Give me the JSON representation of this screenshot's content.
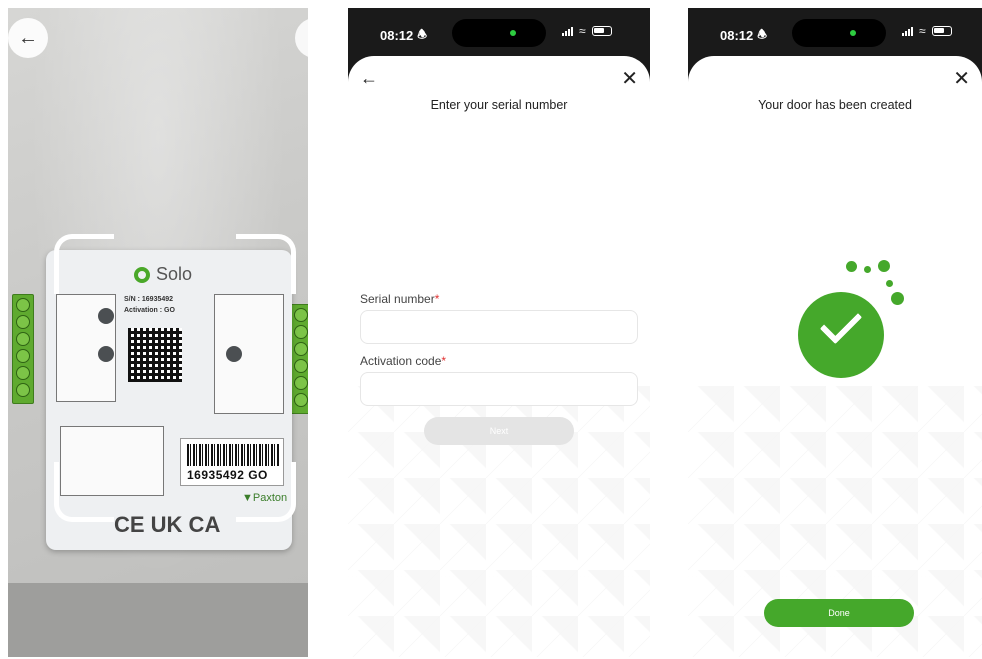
{
  "scan": {
    "back_icon": "arrow-left-icon",
    "device_brand": "Solo",
    "serial_line": "S/N : 16935492",
    "activation_line": "Activation : GO",
    "barcode_text": "16935492 GO",
    "maker": "Paxton",
    "marks": "CE UK CA"
  },
  "serial_screen": {
    "status_time": "08:12",
    "title": "Enter your serial number",
    "serial_label": "Serial number",
    "serial_value": "",
    "activation_label": "Activation code",
    "activation_value": "",
    "required_mark": "*",
    "next_label": "Next"
  },
  "success_screen": {
    "status_time": "08:12",
    "title": "Your door has been created",
    "done_label": "Done"
  },
  "colors": {
    "accent": "#45a82b",
    "required": "#e03131",
    "disabled_button": "#e4e4e4"
  }
}
